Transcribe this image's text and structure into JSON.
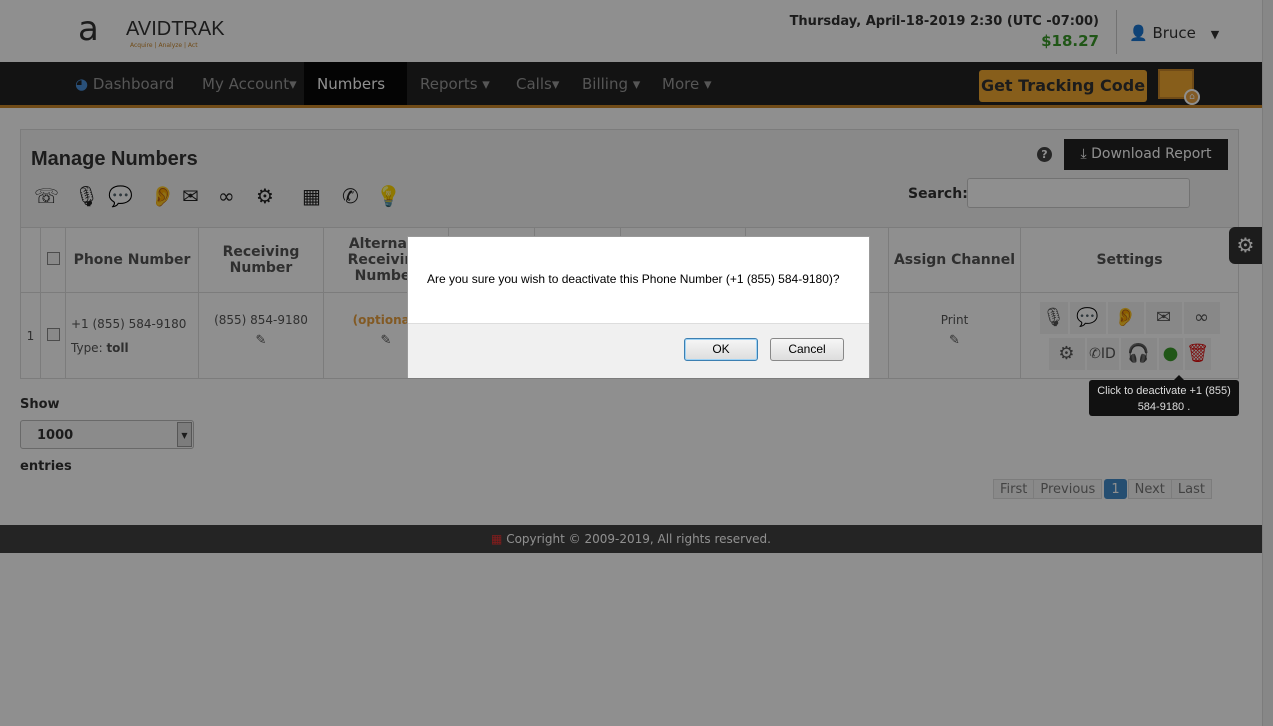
{
  "header": {
    "logo_text": "AVIDTRAK",
    "logo_tagline": "Acquire | Analyze | Act",
    "datetime": "Thursday, April-18-2019 2:30 (UTC -07:00)",
    "balance": "$18.27",
    "user": "Bruce"
  },
  "nav": {
    "items": [
      {
        "label": "Dashboard"
      },
      {
        "label": "My Account▾"
      },
      {
        "label": "Numbers ▾"
      },
      {
        "label": "Reports ▾"
      },
      {
        "label": "Calls▾"
      },
      {
        "label": "Billing ▾"
      },
      {
        "label": "More ▾"
      }
    ],
    "active": "Numbers",
    "tracking_button": "Get Tracking Code"
  },
  "panel": {
    "title": "Manage Numbers",
    "download_label": "Download Report",
    "search_label": "Search:",
    "search_value": ""
  },
  "table": {
    "headers": [
      "",
      "",
      "Phone Number",
      "Receiving Number",
      "Alternate Receiving Number",
      "",
      "",
      "",
      "",
      "Assign Channel",
      "Settings"
    ],
    "rows": [
      {
        "index": "1",
        "phone": "+1 (855) 584-9180",
        "type_label": "Type:",
        "type": "toll",
        "receiving": "(855) 854-9180",
        "alternate": "(optional)",
        "channel": "Print"
      }
    ]
  },
  "length": {
    "show": "Show",
    "value": "1000",
    "entries": "entries"
  },
  "pager": {
    "first": "First",
    "previous": "Previous",
    "current": "1",
    "next": "Next",
    "last": "Last"
  },
  "footer": {
    "text": "Copyright © 2009-2019, All rights reserved."
  },
  "dialog": {
    "message": "Are you sure you wish to deactivate this Phone Number (+1  (855) 584-9180)?",
    "ok": "OK",
    "cancel": "Cancel"
  },
  "tooltip": {
    "text": "Click to deactivate +1 (855) 584-9180 ."
  },
  "colors": {
    "nav_bg": "#222222",
    "accent": "#f0a830",
    "balance": "#3a9a2a",
    "active_bulb": "#3a9a2a",
    "delete": "#dd1111"
  }
}
